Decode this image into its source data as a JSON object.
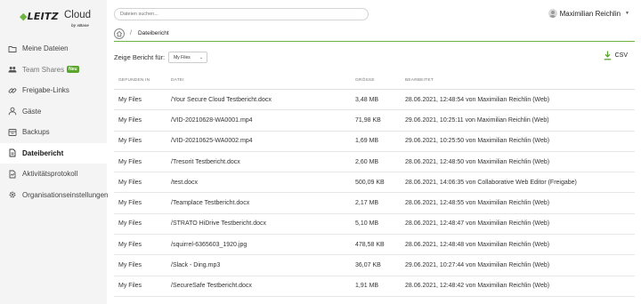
{
  "logo": {
    "brand": "LEITZ",
    "product": "Cloud",
    "byline": "by xBase"
  },
  "sidebar": {
    "items": [
      {
        "label": "Meine Dateien",
        "icon": "folder-icon"
      },
      {
        "label": "Team Shares",
        "icon": "team-icon",
        "badge": "Neu"
      },
      {
        "label": "Freigabe-Links",
        "icon": "link-icon"
      },
      {
        "label": "Gäste",
        "icon": "guest-icon"
      },
      {
        "label": "Backups",
        "icon": "backup-icon"
      },
      {
        "label": "Dateibericht",
        "icon": "report-icon",
        "active": true
      },
      {
        "label": "Aktivitätsprotokoll",
        "icon": "activity-icon"
      },
      {
        "label": "Organisationseinstellungen",
        "icon": "gear-icon"
      }
    ]
  },
  "search": {
    "placeholder": "Dateien suchen..."
  },
  "user": {
    "name": "Maximilian Reichlin"
  },
  "breadcrumb": {
    "current": "Dateibericht",
    "separator": "/"
  },
  "report": {
    "label": "Zeige Bericht für:",
    "selected": "My Files",
    "csv_label": "CSV"
  },
  "table": {
    "headers": [
      "GEFUNDEN IN",
      "DATEI",
      "GRÖSSE",
      "BEARBEITET"
    ],
    "rows": [
      [
        "My Files",
        "/Your Secure Cloud Testbericht.docx",
        "3,48 MB",
        "28.06.2021, 12:48:54 von Maximilian Reichlin (Web)"
      ],
      [
        "My Files",
        "/VID-20210628-WA0001.mp4",
        "71,98 KB",
        "29.06.2021, 10:25:11 von Maximilian Reichlin (Web)"
      ],
      [
        "My Files",
        "/VID-20210625-WA0002.mp4",
        "1,69 MB",
        "29.06.2021, 10:25:50 von Maximilian Reichlin (Web)"
      ],
      [
        "My Files",
        "/Tresorit Testbericht.docx",
        "2,60 MB",
        "28.06.2021, 12:48:50 von Maximilian Reichlin (Web)"
      ],
      [
        "My Files",
        "/test.docx",
        "500,09 KB",
        "28.06.2021, 14:06:35 von Collaborative Web Editor (Freigabe)"
      ],
      [
        "My Files",
        "/Teamplace Testbericht.docx",
        "2,17 MB",
        "28.06.2021, 12:48:55 von Maximilian Reichlin (Web)"
      ],
      [
        "My Files",
        "/STRATO HiDrive Testbericht.docx",
        "5,10 MB",
        "28.06.2021, 12:48:47 von Maximilian Reichlin (Web)"
      ],
      [
        "My Files",
        "/squirrel-6365603_1920.jpg",
        "478,58 KB",
        "28.06.2021, 12:48:48 von Maximilian Reichlin (Web)"
      ],
      [
        "My Files",
        "/Slack - Ding.mp3",
        "36,07 KB",
        "29.06.2021, 10:27:44 von Maximilian Reichlin (Web)"
      ],
      [
        "My Files",
        "/SecureSafe Testbericht.docx",
        "1,91 MB",
        "28.06.2021, 12:48:42 von Maximilian Reichlin (Web)"
      ]
    ]
  },
  "colors": {
    "accent": "#6fb43f",
    "badge": "#5ba52e",
    "sidebar_bg": "#f4f4f4"
  }
}
